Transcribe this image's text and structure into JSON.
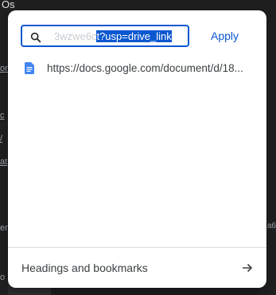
{
  "background": {
    "top_fragment": "Os",
    "left_fragments": [
      "or",
      "c",
      "/",
      "at",
      "er",
      "o"
    ],
    "right_fragment": "a6"
  },
  "link_dialog": {
    "search": {
      "faded_text": "3wzwe6c",
      "selected_text": "t?usp=drive_link",
      "icon": "search-icon"
    },
    "apply_label": "Apply",
    "suggestion": {
      "icon": "google-docs-icon",
      "text": "https://docs.google.com/document/d/18..."
    },
    "footer": {
      "label": "Headings and bookmarks",
      "icon": "arrow-right-icon"
    }
  },
  "colors": {
    "accent": "#0b57d0",
    "doc_blue": "#4285f4",
    "text": "#3c4043",
    "divider": "#dadce0"
  }
}
